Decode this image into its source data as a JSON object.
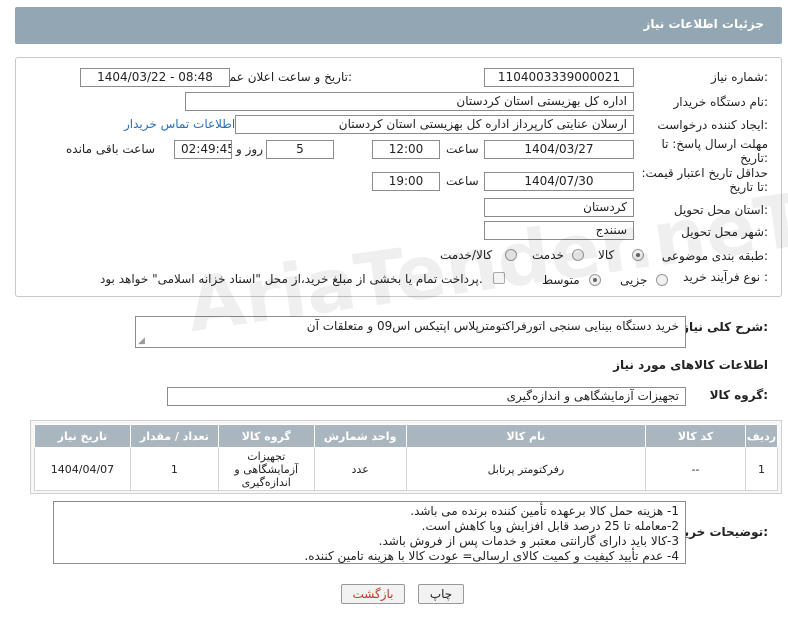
{
  "header": {
    "title": "جزئیات اطلاعات نیاز"
  },
  "form": {
    "need_number_label": "شماره نیاز:",
    "need_number": "1104003339000021",
    "announce_label": "تاریخ و ساعت اعلان عمومی:",
    "announce_value": "1404/03/22 - 08:48",
    "buyer_org_label": "نام دستگاه خریدار:",
    "buyer_org": "اداره کل بهزیستی استان کردستان",
    "requester_label": "ایجاد کننده درخواست:",
    "requester": "ارسلان  عنایتی کارپرداز اداره کل بهزیستی استان کردستان",
    "contact_link": "اطلاعات تماس خریدار",
    "deadline_label": "مهلت ارسال پاسخ: تا تاریخ:",
    "deadline_date": "1404/03/27",
    "time_label": "ساعت",
    "deadline_time": "12:00",
    "days_value": "5",
    "days_label": "روز و",
    "remaining_time": "02:49:45",
    "remaining_label": "ساعت باقی مانده",
    "min_validity_label": "حداقل تاریخ اعتبار قیمت: تا تاریخ:",
    "validity_date": "1404/07/30",
    "validity_time_label": "ساعت",
    "validity_time": "19:00",
    "province_label": "استان محل تحویل:",
    "province": "کردستان",
    "city_label": "شهر محل تحویل:",
    "city": "سنندج",
    "category_label": "طبقه بندی موضوعی:",
    "category_options": [
      "کالا",
      "خدمت",
      "کالا/خدمت"
    ],
    "category_selected": "کالا",
    "process_label": "نوع فرآیند خرید :",
    "process_options": [
      "جزیی",
      "متوسط"
    ],
    "process_selected": "متوسط",
    "payment_note": "پرداخت تمام یا بخشی از مبلغ خرید،از محل \"اسناد خزانه اسلامی\" خواهد بود."
  },
  "description": {
    "label": "شرح کلی نیاز:",
    "value": "خرید دستگاه بینایی سنجی اتورفراکتومترپلاس اپتیکس اس09 و متعلقات آن"
  },
  "goods_section": {
    "title": "اطلاعات کالاهای مورد نیاز",
    "group_label": "گروه کالا:",
    "group_value": "تجهیزات آزمایشگاهی و اندازه‌گیری"
  },
  "table": {
    "headers": [
      "ردیف",
      "کد کالا",
      "نام کالا",
      "واحد شمارش",
      "گروه کالا",
      "تعداد / مقدار",
      "تاریخ نیاز"
    ],
    "rows": [
      [
        "1",
        "--",
        "رفرکتومتر پرتابل",
        "عدد",
        "تجهیزات آزمایشگاهی و اندازه‌گیری",
        "1",
        "1404/04/07"
      ]
    ]
  },
  "buyer_notes": {
    "label": "توضیحات خریدار:",
    "lines": [
      "1- هزینه حمل کالا برعهده تأمین کننده برنده می باشد.",
      "2-معامله تا 25 درصد قابل افزایش ویا کاهش است.",
      "3-کالا باید دارای گارانتی معتبر و خدمات پس از فروش باشد.",
      "4- عدم تأیید کیفیت و کمیت کالای ارسالی= عودت کالا با هزینه تامین کننده."
    ]
  },
  "buttons": {
    "print": "چاپ",
    "back": "بازگشت"
  },
  "watermark": "AriaTender.neT"
}
